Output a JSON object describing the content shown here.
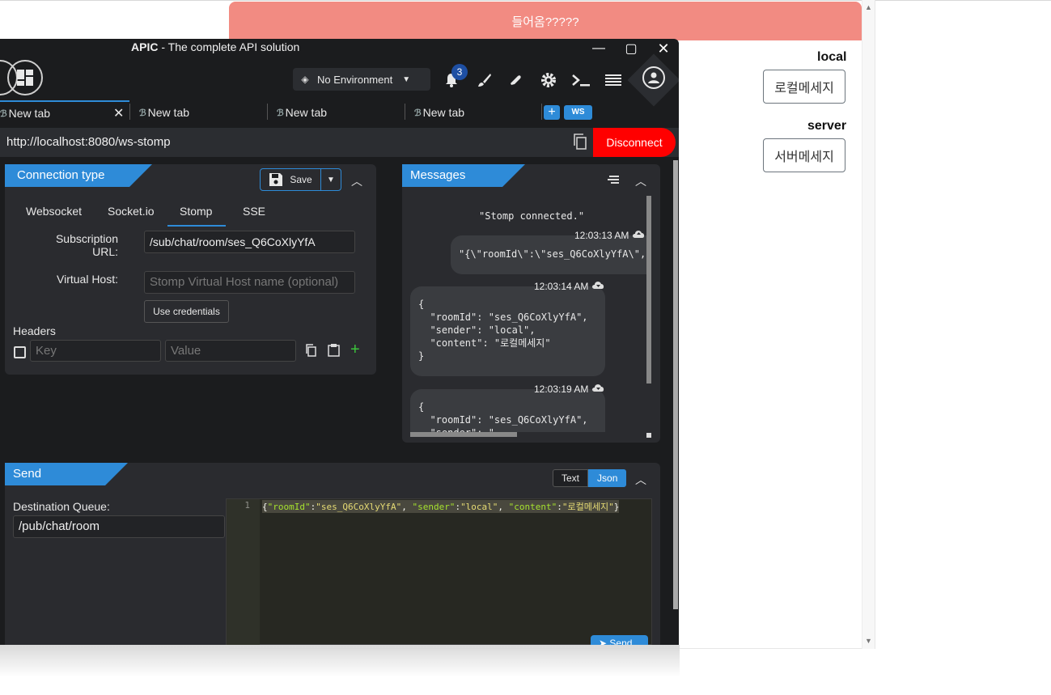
{
  "background_page": {
    "banner": "들어옴?????",
    "local_label": "local",
    "local_button": "로컬메세지",
    "server_label": "server",
    "server_button": "서버메세지",
    "scroll_up": "▲",
    "scroll_down": "▼"
  },
  "window": {
    "title_brand": "APIC",
    "title_rest": " - The complete API solution",
    "controls": {
      "minimize": "—",
      "maximize": "▢",
      "close": "✕"
    }
  },
  "toolbar": {
    "environment": "No Environment",
    "notification_count": "3",
    "icons": [
      "layers-icon",
      "bell-icon",
      "brush-icon",
      "eraser-icon",
      "gear-icon",
      "terminal-icon",
      "menu-icon",
      "user-icon"
    ]
  },
  "tabs": [
    {
      "label": "New tab",
      "active": true
    },
    {
      "label": "New tab",
      "active": false
    },
    {
      "label": "New tab",
      "active": false
    },
    {
      "label": "New tab",
      "active": false
    }
  ],
  "new_tab_ws": "WS",
  "url": "http://localhost:8080/ws-stomp",
  "disconnect_label": "Disconnect",
  "connection": {
    "title": "Connection type",
    "save_label": "Save",
    "types": [
      "Websocket",
      "Socket.io",
      "Stomp",
      "SSE"
    ],
    "selected_type": "Stomp",
    "subscription_label_line1": "Subscription",
    "subscription_label_line2": "URL:",
    "subscription_url": "/sub/chat/room/ses_Q6CoXlyYfA",
    "virtual_host_label": "Virtual Host:",
    "virtual_host_placeholder": "Stomp Virtual Host name (optional)",
    "use_credentials": "Use credentials",
    "headers_label": "Headers",
    "key_placeholder": "Key",
    "value_placeholder": "Value"
  },
  "messages": {
    "title": "Messages",
    "system": "\"Stomp connected.\"",
    "items": [
      {
        "time": "12:03:13 AM",
        "text": "\"{\\\"roomId\\\":\\\"ses_Q6CoXlyYfA\\\","
      },
      {
        "time": "12:03:14 AM",
        "text": "{\n  \"roomId\": \"ses_Q6CoXlyYfA\",\n  \"sender\": \"local\",\n  \"content\": \"로컬메세지\"\n}"
      },
      {
        "time": "12:03:19 AM",
        "text": "{\n  \"roomId\": \"ses_Q6CoXlyYfA\",\n  \"sender\": \"..."
      }
    ]
  },
  "send": {
    "title": "Send",
    "text_toggle": "Text",
    "json_toggle": "Json",
    "destination_label": "Destination Queue:",
    "destination_value": "/pub/chat/room",
    "line_number": "1",
    "code": {
      "open": "{",
      "k1": "\"roomId\"",
      "v1": "\"ses_Q6CoXlyYfA\"",
      "k2": "\"sender\"",
      "v2": "\"local\"",
      "k3": "\"content\"",
      "v3": "\"로컬메세지\"",
      "close": "}"
    },
    "send_label": "Send"
  },
  "colors": {
    "accent": "#2e8bd8",
    "disconnect": "#ff0000",
    "banner": "#f28b82",
    "window_bg": "#1b1c1e"
  }
}
